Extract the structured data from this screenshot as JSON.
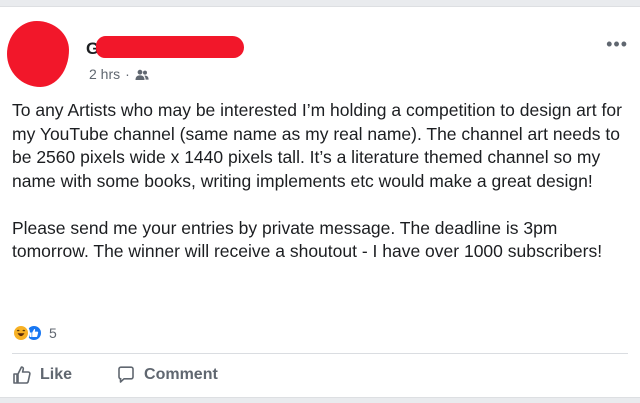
{
  "post": {
    "author_initial": "G",
    "timestamp": "2 hrs",
    "separator": "·",
    "audience_icon": "friends-icon",
    "more_options": "•••",
    "paragraphs": [
      "To any Artists who may be interested I’m holding a competition to design art for my YouTube channel (same name as my real name). The channel art needs to be 2560 pixels wide x 1440 pixels tall. It’s a literature themed channel so my name with some books, writing implements etc would make a great design!",
      "Please send me your entries by private message. The deadline is 3pm tomorrow. The winner will receive a shoutout - I have over 1000 subscribers!"
    ],
    "reactions": {
      "icons": [
        "haha-reaction-icon",
        "like-reaction-icon"
      ],
      "count": "5"
    },
    "actions": {
      "like_label": "Like",
      "comment_label": "Comment"
    }
  },
  "colors": {
    "redaction": "#f2172a",
    "text": "#1c1e21",
    "secondary_text": "#606770",
    "like_blue": "#1877f2",
    "haha_yellow": "#f7b125",
    "background": "#e9ebee"
  }
}
